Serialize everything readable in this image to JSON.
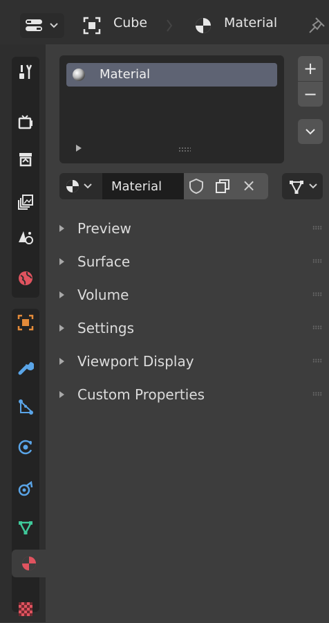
{
  "header": {
    "object_name": "Cube",
    "material_name": "Material"
  },
  "sidebar": {
    "tabs": [
      {
        "id": "tool",
        "icon": "tool-icon"
      },
      {
        "id": "render",
        "icon": "render-icon"
      },
      {
        "id": "output",
        "icon": "output-icon"
      },
      {
        "id": "view-layer",
        "icon": "view-layer-icon"
      },
      {
        "id": "scene",
        "icon": "scene-icon"
      },
      {
        "id": "world",
        "icon": "world-icon"
      },
      {
        "id": "object",
        "icon": "object-icon"
      },
      {
        "id": "modifiers",
        "icon": "wrench-icon"
      },
      {
        "id": "particles",
        "icon": "particles-icon"
      },
      {
        "id": "physics",
        "icon": "physics-icon"
      },
      {
        "id": "constraints",
        "icon": "constraints-icon"
      },
      {
        "id": "data",
        "icon": "mesh-data-icon"
      },
      {
        "id": "material",
        "icon": "material-icon",
        "active": true
      },
      {
        "id": "texture",
        "icon": "texture-icon"
      }
    ]
  },
  "material_slots": {
    "items": [
      {
        "label": "Material"
      }
    ],
    "add_label": "+",
    "remove_label": "−"
  },
  "material_selector": {
    "name": "Material",
    "unlink_label": "×"
  },
  "sections": [
    {
      "label": "Preview"
    },
    {
      "label": "Surface"
    },
    {
      "label": "Volume"
    },
    {
      "label": "Settings"
    },
    {
      "label": "Viewport Display"
    },
    {
      "label": "Custom Properties"
    }
  ],
  "colors": {
    "accent_orange": "#e48b3a",
    "accent_blue": "#5aa5e8",
    "accent_red": "#e0535f",
    "accent_green": "#3fc99a",
    "selection_bg": "#5e6373"
  }
}
